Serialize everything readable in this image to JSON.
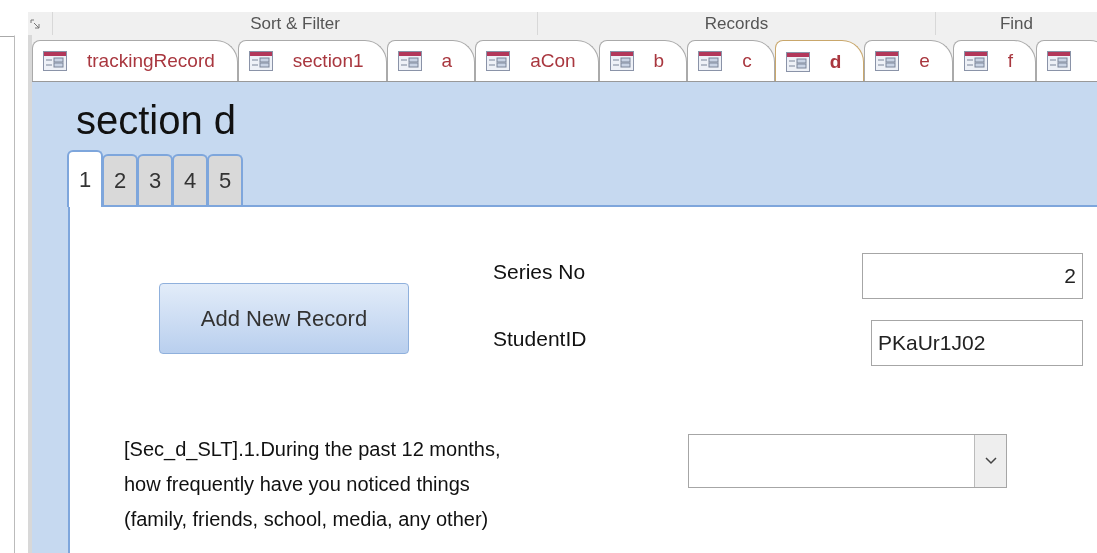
{
  "ribbon": {
    "groups": [
      "Sort & Filter",
      "Records",
      "Find"
    ]
  },
  "document_tabs": [
    {
      "label": "trackingRecord",
      "selected": false
    },
    {
      "label": "section1",
      "selected": false
    },
    {
      "label": "a",
      "selected": false
    },
    {
      "label": "aCon",
      "selected": false
    },
    {
      "label": "b",
      "selected": false
    },
    {
      "label": "c",
      "selected": false
    },
    {
      "label": "d",
      "selected": true
    },
    {
      "label": "e",
      "selected": false
    },
    {
      "label": "f",
      "selected": false
    }
  ],
  "form": {
    "title": "section d",
    "page_tabs": [
      {
        "label": "1",
        "selected": true
      },
      {
        "label": "2",
        "selected": false
      },
      {
        "label": "3",
        "selected": false
      },
      {
        "label": "4",
        "selected": false
      },
      {
        "label": "5",
        "selected": false
      }
    ],
    "button": "Add New Record",
    "fields": [
      {
        "label": "Series No",
        "value": "2",
        "kind": "number"
      },
      {
        "label": "StudentID",
        "value": "PKaUr1J02",
        "kind": "text"
      }
    ],
    "question": {
      "text": "[Sec_d_SLT].1.During the past 12 months, how frequently have you noticed things (family, friends, school, media, any other)"
    }
  }
}
